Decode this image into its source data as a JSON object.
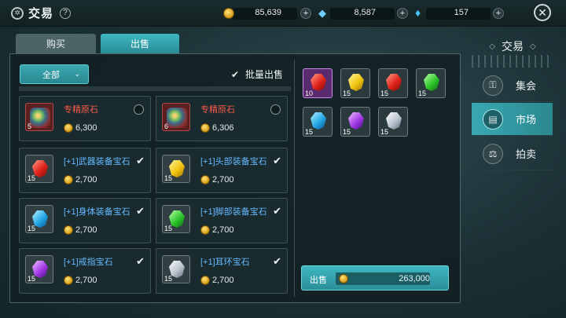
{
  "header": {
    "title": "交易",
    "help": "?",
    "close": "✕"
  },
  "currencies": [
    {
      "icon": "gold-coin-icon",
      "value": "85,639",
      "plus": "+"
    },
    {
      "icon": "blue-crystal-icon",
      "value": "8,587",
      "plus": "+"
    },
    {
      "icon": "diamond-icon",
      "value": "157",
      "plus": "+"
    }
  ],
  "tabs": [
    {
      "label": "购买",
      "active": false
    },
    {
      "label": "出售",
      "active": true
    }
  ],
  "filter": {
    "label": "全部",
    "chevron": "⌄"
  },
  "batch": {
    "label": "批量出售",
    "checked": true
  },
  "items": [
    {
      "name": "专精原石",
      "color": "red",
      "qty": "5",
      "price": "6,300",
      "selected": false,
      "kind": "ore"
    },
    {
      "name": "专精原石",
      "color": "red",
      "qty": "6",
      "price": "6,306",
      "selected": false,
      "kind": "ore"
    },
    {
      "name": "[+1]武器装备宝石",
      "color": "blue",
      "qty": "15",
      "price": "2,700",
      "selected": true,
      "kind": "gem-red"
    },
    {
      "name": "[+1]头部装备宝石",
      "color": "blue",
      "qty": "15",
      "price": "2,700",
      "selected": true,
      "kind": "gem-yellow"
    },
    {
      "name": "[+1]身体装备宝石",
      "color": "blue",
      "qty": "15",
      "price": "2,700",
      "selected": true,
      "kind": "gem-blue"
    },
    {
      "name": "[+1]脚部装备宝石",
      "color": "blue",
      "qty": "15",
      "price": "2,700",
      "selected": true,
      "kind": "gem-green"
    },
    {
      "name": "[+1]戒指宝石",
      "color": "blue",
      "qty": "15",
      "price": "2,700",
      "selected": true,
      "kind": "gem-purple"
    },
    {
      "name": "[+1]耳环宝石",
      "color": "blue",
      "qty": "15",
      "price": "2,700",
      "selected": true,
      "kind": "gem-white"
    }
  ],
  "selected_slots": [
    {
      "qty": "10",
      "kind": "gem-red",
      "highlight": true
    },
    {
      "qty": "15",
      "kind": "gem-yellow"
    },
    {
      "qty": "15",
      "kind": "gem-red"
    },
    {
      "qty": "15",
      "kind": "gem-green"
    },
    {
      "qty": "15",
      "kind": "gem-blue"
    },
    {
      "qty": "15",
      "kind": "gem-purple"
    },
    {
      "qty": "15",
      "kind": "gem-white"
    }
  ],
  "sell": {
    "label": "出售",
    "amount": "263,000"
  },
  "side": {
    "header": "交易",
    "items": [
      {
        "label": "集会",
        "icon": "lock-icon",
        "active": false
      },
      {
        "label": "市场",
        "icon": "shop-icon",
        "active": true
      },
      {
        "label": "拍卖",
        "icon": "scale-icon",
        "active": false
      }
    ]
  }
}
